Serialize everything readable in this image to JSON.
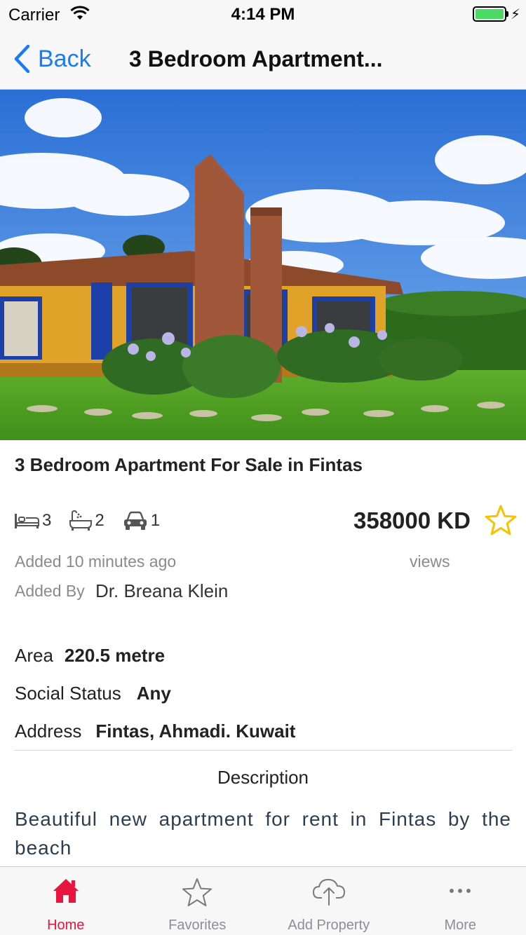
{
  "status_bar": {
    "carrier": "Carrier",
    "time": "4:14 PM",
    "battery_level": 1.0,
    "charging_glyph": "⚡"
  },
  "nav": {
    "back_label": "Back",
    "title": "3 Bedroom Apartment..."
  },
  "hero": {
    "image": "house-photo"
  },
  "property": {
    "title": "3 Bedroom Apartment For Sale in Fintas",
    "bedrooms": "3",
    "bathrooms": "2",
    "parking": "1",
    "price": "358000 KD",
    "added_time": "Added 10 minutes ago",
    "views_label": "views",
    "added_by_label": "Added By",
    "added_by_name": "Dr. Breana Klein"
  },
  "details": [
    {
      "label": "Area",
      "value": "220.5 metre"
    },
    {
      "label": "Social Status",
      "value": "Any"
    },
    {
      "label": "Address",
      "value": "Fintas, Ahmadi. Kuwait"
    }
  ],
  "description": {
    "heading": "Description",
    "text": "Beautiful new apartment for rent in Fintas by the beach"
  },
  "tabs": [
    {
      "label": "Home",
      "icon": "home-icon",
      "active": true
    },
    {
      "label": "Favorites",
      "icon": "star-icon",
      "active": false
    },
    {
      "label": "Add Property",
      "icon": "cloud-upload-icon",
      "active": false
    },
    {
      "label": "More",
      "icon": "more-dots-icon",
      "active": false
    }
  ],
  "colors": {
    "accent": "#1a7cf5",
    "active_tab": "#e8163f",
    "star": "#f5c400",
    "battery": "#4cd964"
  }
}
